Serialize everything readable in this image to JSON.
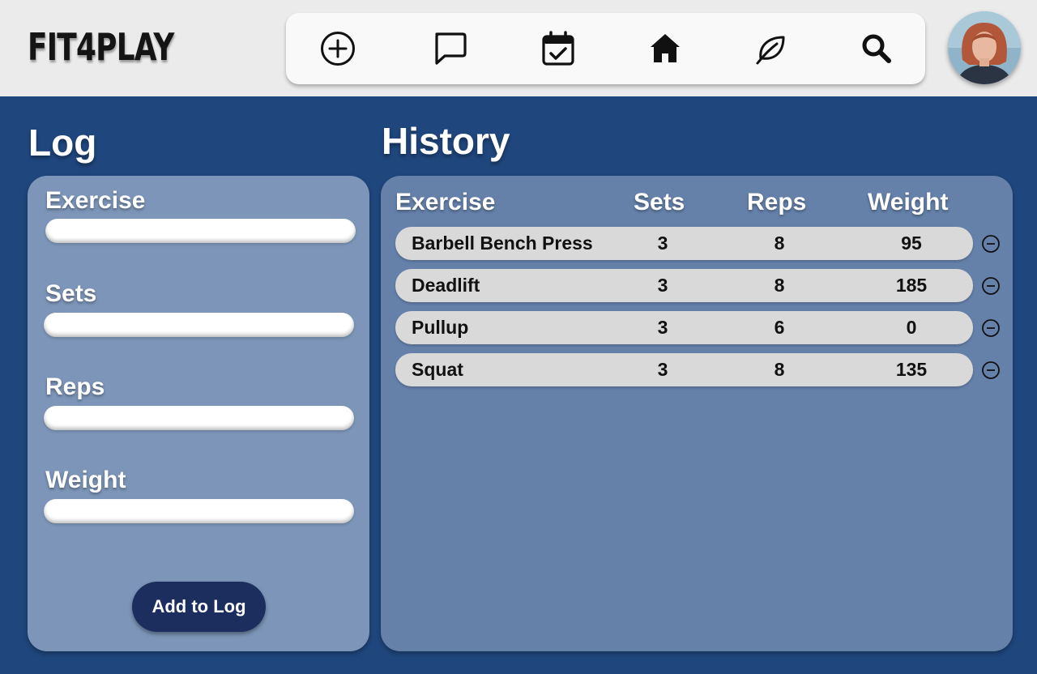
{
  "app": {
    "logo": "FIT4PLAY"
  },
  "nav": {
    "items": [
      {
        "name": "add",
        "icon": "plus-circle-icon"
      },
      {
        "name": "messages",
        "icon": "chat-bubble-icon"
      },
      {
        "name": "calendar",
        "icon": "calendar-check-icon"
      },
      {
        "name": "home",
        "icon": "home-icon"
      },
      {
        "name": "nutrition",
        "icon": "leaf-icon"
      },
      {
        "name": "search",
        "icon": "search-icon"
      }
    ]
  },
  "log": {
    "title": "Log",
    "fields": [
      {
        "label": "Exercise",
        "value": ""
      },
      {
        "label": "Sets",
        "value": ""
      },
      {
        "label": "Reps",
        "value": ""
      },
      {
        "label": "Weight",
        "value": ""
      }
    ],
    "add_button": "Add to Log"
  },
  "history": {
    "title": "History",
    "columns": [
      "Exercise",
      "Sets",
      "Reps",
      "Weight"
    ],
    "rows": [
      {
        "exercise": "Barbell Bench Press",
        "sets": "3",
        "reps": "8",
        "weight": "95"
      },
      {
        "exercise": "Deadlift",
        "sets": "3",
        "reps": "8",
        "weight": "185"
      },
      {
        "exercise": "Pullup",
        "sets": "3",
        "reps": "6",
        "weight": "0"
      },
      {
        "exercise": "Squat",
        "sets": "3",
        "reps": "8",
        "weight": "135"
      }
    ]
  },
  "colors": {
    "background": "#1f467d",
    "topbar": "#ebebeb",
    "log_panel": "#7c95b8",
    "history_panel": "#6581aa",
    "row": "#d9d9d9",
    "button": "#1c2e5e"
  }
}
